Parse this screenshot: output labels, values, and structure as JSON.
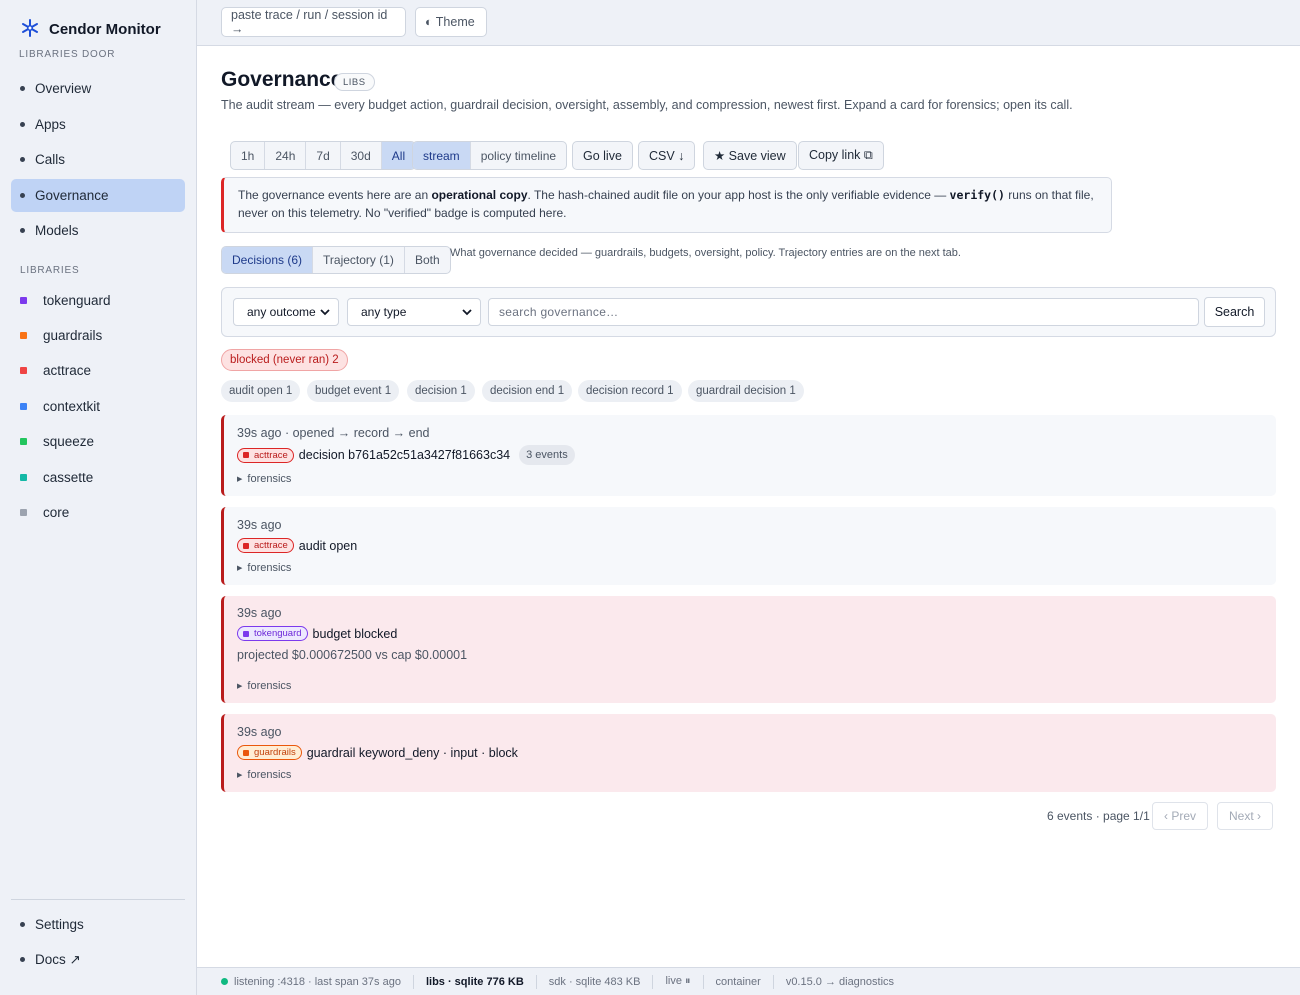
{
  "app": {
    "name": "Cendor Monitor",
    "subtitle": "LIBRARIES DOOR"
  },
  "nav": [
    {
      "label": "Overview",
      "active": false
    },
    {
      "label": "Apps",
      "active": false
    },
    {
      "label": "Calls",
      "active": false
    },
    {
      "label": "Governance",
      "active": true
    },
    {
      "label": "Models",
      "active": false
    }
  ],
  "libraries_label": "LIBRARIES",
  "libraries": [
    {
      "label": "tokenguard",
      "color": "#7c3aed"
    },
    {
      "label": "guardrails",
      "color": "#f97316"
    },
    {
      "label": "acttrace",
      "color": "#ef4444"
    },
    {
      "label": "contextkit",
      "color": "#3b82f6"
    },
    {
      "label": "squeeze",
      "color": "#22c55e"
    },
    {
      "label": "cassette",
      "color": "#14b8a6"
    },
    {
      "label": "core",
      "color": "#9ca3af"
    }
  ],
  "bottom_nav": [
    {
      "label": "Settings"
    },
    {
      "label": "Docs ↗"
    }
  ],
  "topbar": {
    "trace_placeholder": "paste trace / run / session id →",
    "theme_label": "◐ Theme"
  },
  "page": {
    "title": "Governance",
    "badge": "LIBS",
    "subtitle": "The audit stream — every budget action, guardrail decision, oversight, assembly, and compression, newest first. Expand a card for forensics; open its call."
  },
  "toolbar": {
    "ranges": [
      "1h",
      "24h",
      "7d",
      "30d",
      "All"
    ],
    "active_range": "All",
    "views": [
      "stream",
      "policy timeline"
    ],
    "active_view": "stream",
    "go_live": "Go live",
    "csv": "CSV ↓",
    "save_view": "★ Save view",
    "copy_link": "Copy link ⧉"
  },
  "notice": {
    "part1": "The governance events here are an ",
    "bold": "operational copy",
    "part2": ". The hash-chained audit file on your app host is the only verifiable evidence — ",
    "code": "verify()",
    "part3": " runs on that file, never on this telemetry. No \"verified\" badge is computed here."
  },
  "tabs": {
    "items": [
      "Decisions (6)",
      "Trajectory (1)",
      "Both"
    ],
    "active": "Decisions (6)",
    "hint": "What governance decided — guardrails, budgets, oversight, policy. Trajectory entries are on the next tab."
  },
  "filters": {
    "outcome": "any outcome",
    "type": "any type",
    "search_placeholder": "search governance…",
    "search_button": "Search"
  },
  "outcome_chips": [
    {
      "label": "blocked (never ran) 2"
    }
  ],
  "type_chips": [
    {
      "label": "audit open 1"
    },
    {
      "label": "budget event 1"
    },
    {
      "label": "decision 1"
    },
    {
      "label": "decision end 1"
    },
    {
      "label": "decision record 1"
    },
    {
      "label": "guardrail decision 1"
    }
  ],
  "events": [
    {
      "time": "39s ago · opened → record → end",
      "tag": "acttrace",
      "heading": "decision b761a52c51a3427f81663c34",
      "count": "3 events",
      "detail": "",
      "forensics": "forensics"
    },
    {
      "time": "39s ago",
      "tag": "acttrace",
      "heading": "audit open",
      "count": "",
      "detail": "",
      "forensics": "forensics"
    },
    {
      "time": "39s ago",
      "tag": "tokenguard",
      "heading": "budget blocked",
      "count": "",
      "detail": "projected $0.000672500 vs cap $0.00001",
      "forensics": "forensics"
    },
    {
      "time": "39s ago",
      "tag": "guardrails",
      "heading": "guardrail keyword_deny · input · block",
      "count": "",
      "detail": "",
      "forensics": "forensics"
    }
  ],
  "pager": {
    "summary": "6 events · page 1/1",
    "prev": "‹ Prev",
    "next": "Next ›"
  },
  "status": {
    "listening": "listening :4318 · last span 37s ago",
    "libs": "libs · sqlite 776 KB",
    "sdk": "sdk · sqlite 483 KB",
    "live": "live ⏸",
    "container": "container",
    "version": "v0.15.0 → diagnostics"
  }
}
